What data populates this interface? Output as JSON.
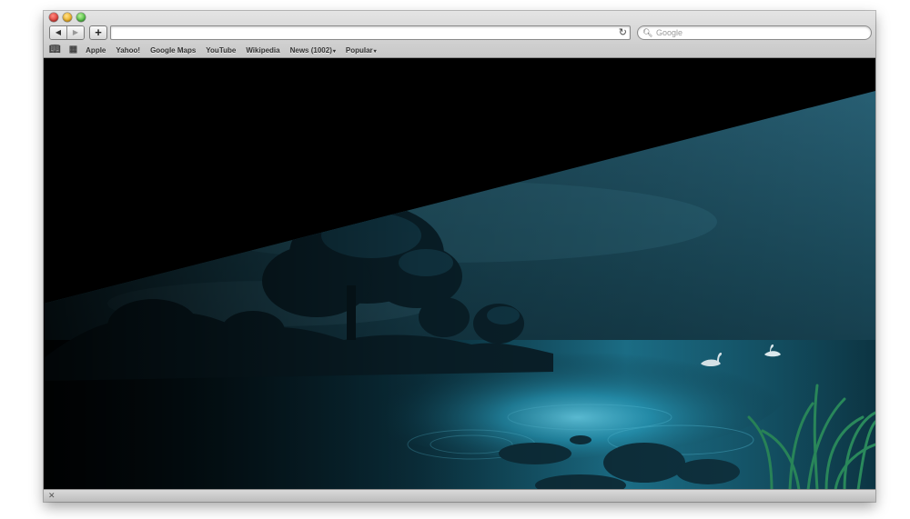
{
  "browser": {
    "search_placeholder": "Google",
    "reload_icon": "reload-icon",
    "back_label": "◀",
    "forward_label": "▶",
    "add_label": "+",
    "status_close": "✕"
  },
  "bookmarks": [
    {
      "label": "Apple"
    },
    {
      "label": "Yahoo!"
    },
    {
      "label": "Google Maps"
    },
    {
      "label": "YouTube"
    },
    {
      "label": "Wikipedia"
    },
    {
      "label": "News (1002)",
      "caret": "▾"
    },
    {
      "label": "Popular",
      "caret": "▾"
    }
  ],
  "colors": {
    "lake_glow": "#3fc6e6",
    "sky": "#1d4f63",
    "foliage": "#0b2530"
  }
}
